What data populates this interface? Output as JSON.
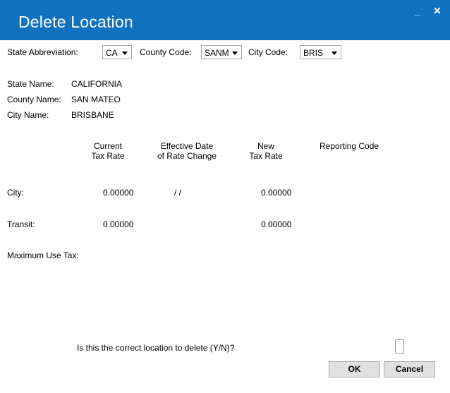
{
  "window": {
    "title": "Delete Location",
    "minimize_glyph": "_",
    "close_glyph": "✕"
  },
  "selectors": {
    "state_label": "State Abbreviation:",
    "state_value": "CA",
    "county_label": "County Code:",
    "county_value": "SANM",
    "city_label": "City Code:",
    "city_value": "BRIS"
  },
  "names": {
    "state_label": "State Name:",
    "state_value": "CALIFORNIA",
    "county_label": "County Name:",
    "county_value": "SAN MATEO",
    "city_label": "City Name:",
    "city_value": "BRISBANE"
  },
  "columns": {
    "current_1": "Current",
    "current_2": "Tax Rate",
    "effective_1": "Effective Date",
    "effective_2": "of Rate Change",
    "new_1": "New",
    "new_2": "Tax Rate",
    "reporting": "Reporting Code"
  },
  "rows": {
    "city_label": "City:",
    "city_current": "0.00000",
    "city_effective": "/ /",
    "city_new": "0.00000",
    "transit_label": "Transit:",
    "transit_current": "0.00000",
    "transit_new": "0.00000",
    "max_use_label": "Maximum Use Tax:"
  },
  "confirm": {
    "question": "Is this the correct location to delete (Y/N)?",
    "ok_label": "OK",
    "cancel_label": "Cancel"
  }
}
